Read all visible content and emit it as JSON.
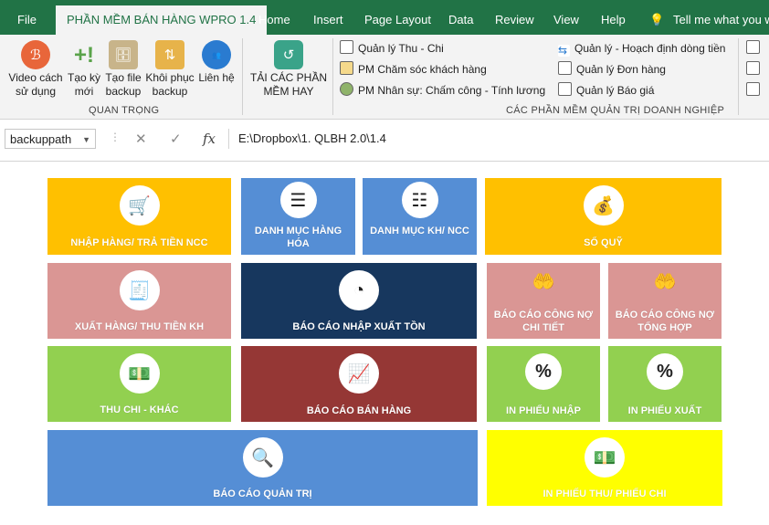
{
  "tabs": [
    {
      "label": "File"
    },
    {
      "label": "PHẦN MỀM BÁN HÀNG WPRO 1.4"
    },
    {
      "label": "Home"
    },
    {
      "label": "Insert"
    },
    {
      "label": "Page Layout"
    },
    {
      "label": "Data"
    },
    {
      "label": "Review"
    },
    {
      "label": "View"
    },
    {
      "label": "Help"
    },
    {
      "label": "Tell me what you wa"
    }
  ],
  "ribbon": {
    "group1": {
      "buttons": [
        {
          "label": "Video cách sử dụng",
          "icon": "video-icon"
        },
        {
          "label": "Tạo kỳ mới",
          "icon": "new-period-icon"
        },
        {
          "label": "Tạo file backup",
          "icon": "backup-icon"
        },
        {
          "label": "Khôi phục backup",
          "icon": "restore-icon"
        },
        {
          "label": "Liên hệ",
          "icon": "about-us-icon"
        }
      ],
      "label": "QUAN TRỌNG"
    },
    "download": {
      "label": "TẢI CÁC PHẦN MỀM HAY"
    },
    "group2": {
      "col1": [
        "Quản lý Thu - Chi",
        "PM Chăm sóc khách hàng",
        "PM Nhân sự: Chấm công - Tính lương"
      ],
      "col2": [
        "Quản lý - Hoạch định dòng tiền",
        "Quản lý Đơn hàng",
        "Quản lý Báo giá"
      ],
      "label": "CÁC PHẦN MỀM QUẢN TRỊ DOANH NGHIỆP"
    }
  },
  "formula_bar": {
    "name_box": "backuppath",
    "cancel": "✕",
    "enter": "✓",
    "fx": "fx",
    "formula": "E:\\Dropbox\\1. QLBH 2.0\\1.4"
  },
  "tiles": [
    {
      "label": "NHẬP HÀNG/ TRẢ TIỀN NCC",
      "color": "#FFC000",
      "icon": "shopping-cart-icon"
    },
    {
      "label": "DANH MỤC HÀNG HÓA",
      "color": "#558ED5",
      "icon": "list-icon"
    },
    {
      "label": "DANH MỤC KH/ NCC",
      "color": "#558ED5",
      "icon": "contact-list-icon"
    },
    {
      "label": "SỔ QUỸ",
      "color": "#FFC000",
      "icon": "money-bag-icon"
    },
    {
      "label": "XUẤT HÀNG/ THU TIỀN KH",
      "color": "#DA9694",
      "icon": "invoice-icon"
    },
    {
      "label": "BÁO CÁO NHẬP XUẤT TỒN",
      "color": "#17375E",
      "icon": "pie-chart-icon"
    },
    {
      "label": "BÁO CÁO CÔNG NỢ CHI TIẾT",
      "color": "#DA9694",
      "icon": "debt-detail-icon"
    },
    {
      "label": "BÁO CÁO CÔNG NỢ TỔNG HỢP",
      "color": "#DA9694",
      "icon": "debt-summary-icon"
    },
    {
      "label": "THU CHI - KHÁC",
      "color": "#92D050",
      "icon": "cash-icon"
    },
    {
      "label": "BÁO CÁO BÁN HÀNG",
      "color": "#953735",
      "icon": "bar-chart-icon"
    },
    {
      "label": "IN PHIẾU NHẬP",
      "color": "#92D050",
      "icon": "voucher-icon"
    },
    {
      "label": "IN PHIẾU XUẤT",
      "color": "#92D050",
      "icon": "voucher-icon"
    },
    {
      "label": "BÁO CÁO QUẢN TRỊ",
      "color": "#558ED5",
      "icon": "analysis-icon"
    },
    {
      "label": "IN PHIẾU THU/ PHIẾU CHI",
      "color": "#FFFF00",
      "icon": "cash-icon"
    }
  ]
}
